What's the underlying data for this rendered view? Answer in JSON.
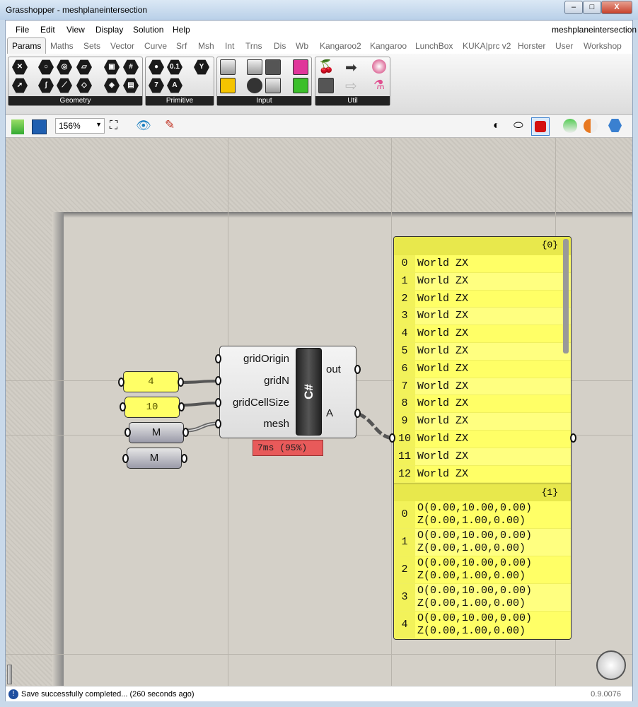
{
  "window": {
    "title": "Grasshopper - meshplaneintersection",
    "min": "–",
    "max": "□",
    "close": "X"
  },
  "menu": [
    "File",
    "Edit",
    "View",
    "Display",
    "Solution",
    "Help"
  ],
  "document_name": "meshplaneintersection",
  "tabs": [
    "Params",
    "Maths",
    "Sets",
    "Vector",
    "Curve",
    "Srf",
    "Msh",
    "Int",
    "Trns",
    "Dis",
    "Wb",
    "Kangaroo2",
    "Kangaroo",
    "LunchBox",
    "KUKA|prc v2",
    "Horster",
    "User",
    "Workshop"
  ],
  "active_tab": "Params",
  "ribbon_groups": [
    "Geometry",
    "Primitive",
    "Input",
    "Util"
  ],
  "primitive_labels": [
    "0.1",
    "7",
    "A"
  ],
  "toolbar": {
    "zoom": "156%"
  },
  "canvas": {
    "number_params": [
      "4",
      "10"
    ],
    "mesh_params": [
      "M",
      "M"
    ],
    "component": {
      "inputs": [
        "gridOrigin",
        "gridN",
        "gridCellSize",
        "mesh"
      ],
      "outputs": [
        "out",
        "A"
      ],
      "label": "C#",
      "profiler": "7ms (95%)"
    },
    "panel": {
      "branch0": "{0}",
      "rows0": [
        [
          "0",
          "World ZX"
        ],
        [
          "1",
          "World ZX"
        ],
        [
          "2",
          "World ZX"
        ],
        [
          "3",
          "World ZX"
        ],
        [
          "4",
          "World ZX"
        ],
        [
          "5",
          "World ZX"
        ],
        [
          "6",
          "World ZX"
        ],
        [
          "7",
          "World ZX"
        ],
        [
          "8",
          "World ZX"
        ],
        [
          "9",
          "World ZX"
        ],
        [
          "10",
          "World ZX"
        ],
        [
          "11",
          "World ZX"
        ],
        [
          "12",
          "World ZX"
        ]
      ],
      "branch1": "{1}",
      "rows1": [
        [
          "0",
          "O(0.00,10.00,0.00)",
          "Z(0.00,1.00,0.00)"
        ],
        [
          "1",
          "O(0.00,10.00,0.00)",
          "Z(0.00,1.00,0.00)"
        ],
        [
          "2",
          "O(0.00,10.00,0.00)",
          "Z(0.00,1.00,0.00)"
        ],
        [
          "3",
          "O(0.00,10.00,0.00)",
          "Z(0.00,1.00,0.00)"
        ],
        [
          "4",
          "O(0.00,10.00,0.00)",
          "Z(0.00,1.00,0.00)"
        ]
      ]
    }
  },
  "status": {
    "message": "Save successfully completed... (260 seconds ago)",
    "version": "0.9.0076"
  }
}
